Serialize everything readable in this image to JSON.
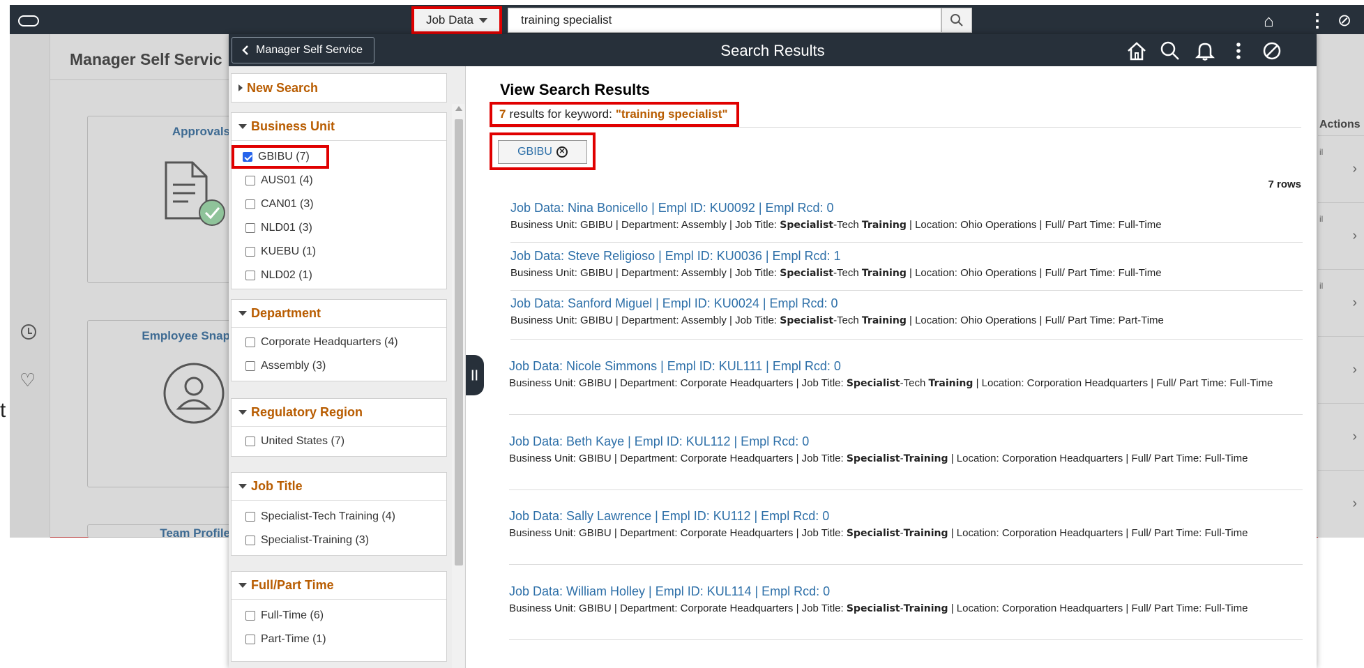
{
  "background": {
    "title": "Manager Self Servic",
    "tiles": [
      {
        "title": "Approvals"
      },
      {
        "title": "Employee Snap"
      },
      {
        "title": "Team Profile"
      }
    ],
    "stray_char": "t",
    "actions_label": "Actions",
    "row_snippet": "il"
  },
  "searchbar": {
    "category": "Job Data",
    "query": "training specialist"
  },
  "modal": {
    "back_label": "Manager Self Service",
    "title": "Search Results"
  },
  "filters": {
    "new_search": "New Search",
    "groups": [
      {
        "title": "Business Unit",
        "options": [
          "GBIBU (7)",
          "AUS01 (4)",
          "CAN01 (3)",
          "NLD01 (3)",
          "KUEBU (1)",
          "NLD02 (1)"
        ]
      },
      {
        "title": "Department",
        "options": [
          "Corporate Headquarters (4)",
          "Assembly (3)"
        ]
      },
      {
        "title": "Regulatory Region",
        "options": [
          "United States (7)"
        ]
      },
      {
        "title": "Job Title",
        "options": [
          "Specialist-Tech Training (4)",
          "Specialist-Training (3)"
        ]
      },
      {
        "title": "Full/Part Time",
        "options": [
          "Full-Time (6)",
          "Part-Time (1)"
        ]
      }
    ]
  },
  "results": {
    "heading": "View Search Results",
    "count": "7",
    "count_text": "results for keyword:",
    "keyword": "\"training specialist\"",
    "active_filter": "GBIBU",
    "rows_label": "7 rows",
    "items": [
      {
        "title": "Job Data: Nina Bonicello | Empl ID: KU0092 | Empl Rcd: 0",
        "pre": "Business Unit: GBIBU | Department: Assembly | Job Title: ",
        "hl1": "Specialist",
        "mid": "-Tech ",
        "hl2": "Training",
        "post": " | Location: Ohio Operations | Full/ Part Time: Full-Time"
      },
      {
        "title": "Job Data: Steve Religioso | Empl ID: KU0036 | Empl Rcd: 1",
        "pre": "Business Unit: GBIBU | Department: Assembly | Job Title: ",
        "hl1": "Specialist",
        "mid": "-Tech ",
        "hl2": "Training",
        "post": " | Location: Ohio Operations | Full/ Part Time: Full-Time"
      },
      {
        "title": "Job Data: Sanford Miguel | Empl ID: KU0024 | Empl Rcd: 0",
        "pre": "Business Unit: GBIBU | Department: Assembly | Job Title: ",
        "hl1": "Specialist",
        "mid": "-Tech ",
        "hl2": "Training",
        "post": " | Location: Ohio Operations | Full/ Part Time: Part-Time"
      },
      {
        "title": "Job Data: Nicole Simmons | Empl ID: KUL111 | Empl Rcd: 0",
        "pre": "Business Unit: GBIBU | Department: Corporate Headquarters | Job Title: ",
        "hl1": "Specialist",
        "mid": "-Tech ",
        "hl2": "Training",
        "post": " | Location: Corporation Headquarters | Full/ Part Time: Full-Time"
      },
      {
        "title": "Job Data: Beth Kaye | Empl ID: KUL112 | Empl Rcd: 0",
        "pre": "Business Unit: GBIBU | Department: Corporate Headquarters | Job Title: ",
        "hl1": "Specialist",
        "mid": "-",
        "hl2": "Training",
        "post": " | Location: Corporation Headquarters | Full/ Part Time: Full-Time"
      },
      {
        "title": "Job Data: Sally Lawrence | Empl ID: KU112 | Empl Rcd: 0",
        "pre": "Business Unit: GBIBU | Department: Corporate Headquarters | Job Title: ",
        "hl1": "Specialist",
        "mid": "-",
        "hl2": "Training",
        "post": " | Location: Corporation Headquarters | Full/ Part Time: Full-Time"
      },
      {
        "title": "Job Data: William Holley | Empl ID: KUL114 | Empl Rcd: 0",
        "pre": "Business Unit: GBIBU | Department: Corporate Headquarters | Job Title: ",
        "hl1": "Specialist",
        "mid": "-",
        "hl2": "Training",
        "post": " | Location: Corporation Headquarters | Full/ Part Time: Full-Time"
      }
    ]
  },
  "colors": {
    "topbar": "#27303a",
    "accent": "#b85c00",
    "link": "#2d6fa8",
    "highlight": "#e00000"
  }
}
